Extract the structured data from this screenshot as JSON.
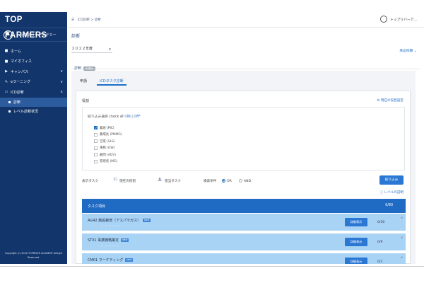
{
  "sidebar": {
    "logo": "TOP FARMERS",
    "profile_name": "トップリバー アカデミー",
    "items": [
      {
        "icon": "home-icon",
        "glyph": "■",
        "label": "ホーム"
      },
      {
        "icon": "office-icon",
        "glyph": "■",
        "label": "マイオフィス"
      },
      {
        "icon": "campus-icon",
        "glyph": "▶",
        "label": "キャンパス",
        "chevron": "∨"
      },
      {
        "icon": "elearning-icon",
        "glyph": "✎",
        "label": "eラーニング",
        "chevron": "∨"
      },
      {
        "icon": "icd-icon",
        "glyph": "▭",
        "label": "iCD診断",
        "chevron": "∧"
      }
    ],
    "subitems": [
      {
        "label": "診断",
        "active": true
      },
      {
        "label": "レベル診断状況",
        "active": false
      }
    ],
    "copyright": "Copyright (c) 2022 TOPRIVER ACADEMY Allright Reserved."
  },
  "topbar": {
    "home_glyph": "☰",
    "breadcrumb": "iCD診断 > 診断",
    "user_name": "トップリバーア..."
  },
  "main": {
    "title": "診断",
    "year": "２０２２年度",
    "approve_link": "承認依頼",
    "tab_label": "診断",
    "tab_badge": "未提出",
    "subtabs": [
      "申請",
      "iCDタスク診断"
    ],
    "panel_title": "役割",
    "settings_link": "現在の役割設定",
    "filter_label": "絞り込み選択 check All",
    "filter_on": "ON",
    "filter_sep": "|",
    "filter_off": "OFF",
    "roles": [
      {
        "label": "栽培 (PIC)",
        "checked": true
      },
      {
        "label": "農場長 (PMMG)",
        "checked": false
      },
      {
        "label": "営業 (SLS)",
        "checked": false
      },
      {
        "label": "事務 (OW)",
        "checked": false
      },
      {
        "label": "顧問 (ADV)",
        "checked": false
      },
      {
        "label": "管理者 (MG)",
        "checked": false
      }
    ],
    "display_task_label": "表示タスク",
    "current_role_label": "現在の役割",
    "assigned_task_label": "担当タスク",
    "search_cond_label": "検索条件",
    "or_label": "OR",
    "and_label": "AND",
    "filter_button": "絞り込み",
    "level_link": "レベルの説明",
    "task_header": "タスク項目",
    "task_header_count": "0/80",
    "tasks": [
      {
        "name": "AG42 施設栽培（アスパラガス）",
        "tag": "NEW",
        "stars": "☆☆☆☆☆",
        "detail": "詳細表示",
        "score": "0/30",
        "more": "∨"
      },
      {
        "name": "ST01 事業戦略策定",
        "tag": "NEW",
        "stars": "☆☆☆☆☆",
        "detail": "詳細表示",
        "score": "0/9",
        "more": "∨"
      },
      {
        "name": "CM01 マーケティング",
        "tag": "NEW",
        "stars": "☆☆☆☆☆",
        "detail": "詳細表示",
        "score": "0/1",
        "more": "∨"
      }
    ]
  },
  "colors": {
    "sidebar": "#12356b",
    "accent": "#1f6fc9",
    "task_header": "#1f6ac2",
    "task_row": "#a9d3f5"
  }
}
